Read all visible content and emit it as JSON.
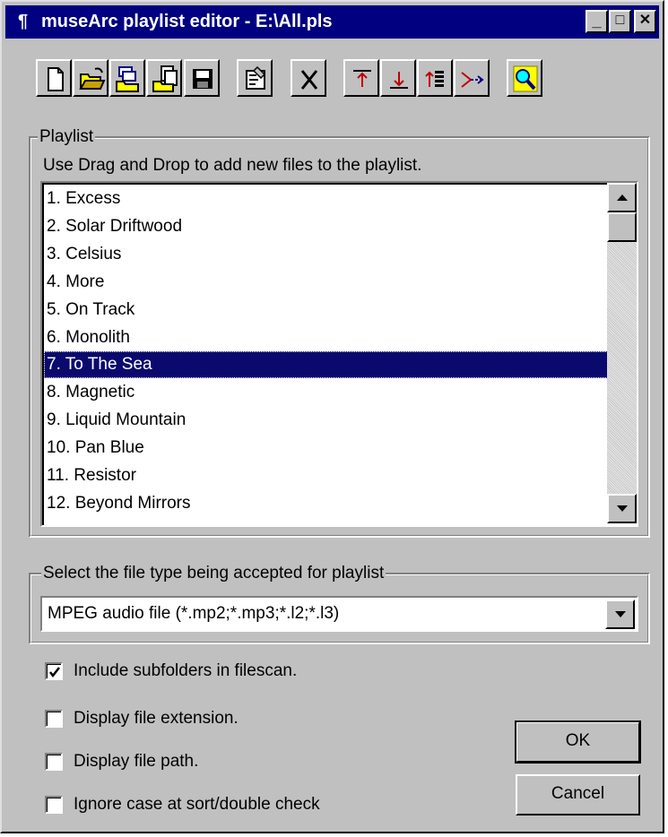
{
  "window": {
    "title": "museArc playlist editor - E:\\All.pls",
    "app_icon": "¶",
    "controls": {
      "minimize": "_",
      "maximize": "□",
      "close": "✕"
    }
  },
  "toolbar": {
    "buttons": [
      {
        "name": "new-file-icon"
      },
      {
        "name": "open-folder-icon"
      },
      {
        "name": "open-multiple-icon"
      },
      {
        "name": "copy-files-icon"
      },
      {
        "name": "save-icon"
      },
      {
        "name": "properties-icon"
      },
      {
        "name": "delete-icon"
      },
      {
        "name": "move-top-icon"
      },
      {
        "name": "move-bottom-icon"
      },
      {
        "name": "sort-icon"
      },
      {
        "name": "merge-icon"
      },
      {
        "name": "search-icon"
      }
    ]
  },
  "playlist": {
    "group_label": "Playlist",
    "hint": "Use Drag and Drop to add new files to the playlist.",
    "items": [
      "1. Excess",
      "2. Solar Driftwood",
      "3. Celsius",
      "4. More",
      "5. On Track",
      "6. Monolith",
      "7. To The Sea",
      "8. Magnetic",
      "9. Liquid Mountain",
      "10. Pan Blue",
      "11. Resistor",
      "12. Beyond Mirrors"
    ],
    "selected_index": 6
  },
  "filetype": {
    "group_label": "Select the file type being accepted for playlist",
    "selected": "MPEG audio file (*.mp2;*.mp3;*.l2;*.l3)"
  },
  "options": [
    {
      "label": "Include subfolders in filescan.",
      "checked": true
    },
    {
      "label": "Display file extension.",
      "checked": false
    },
    {
      "label": "Display file path.",
      "checked": false
    },
    {
      "label": "Ignore case at sort/double check",
      "checked": false
    }
  ],
  "buttons": {
    "ok": "OK",
    "cancel": "Cancel"
  },
  "colors": {
    "titlebar": "#000080",
    "selection": "#0a0a6e",
    "face": "#c0c0c0"
  }
}
